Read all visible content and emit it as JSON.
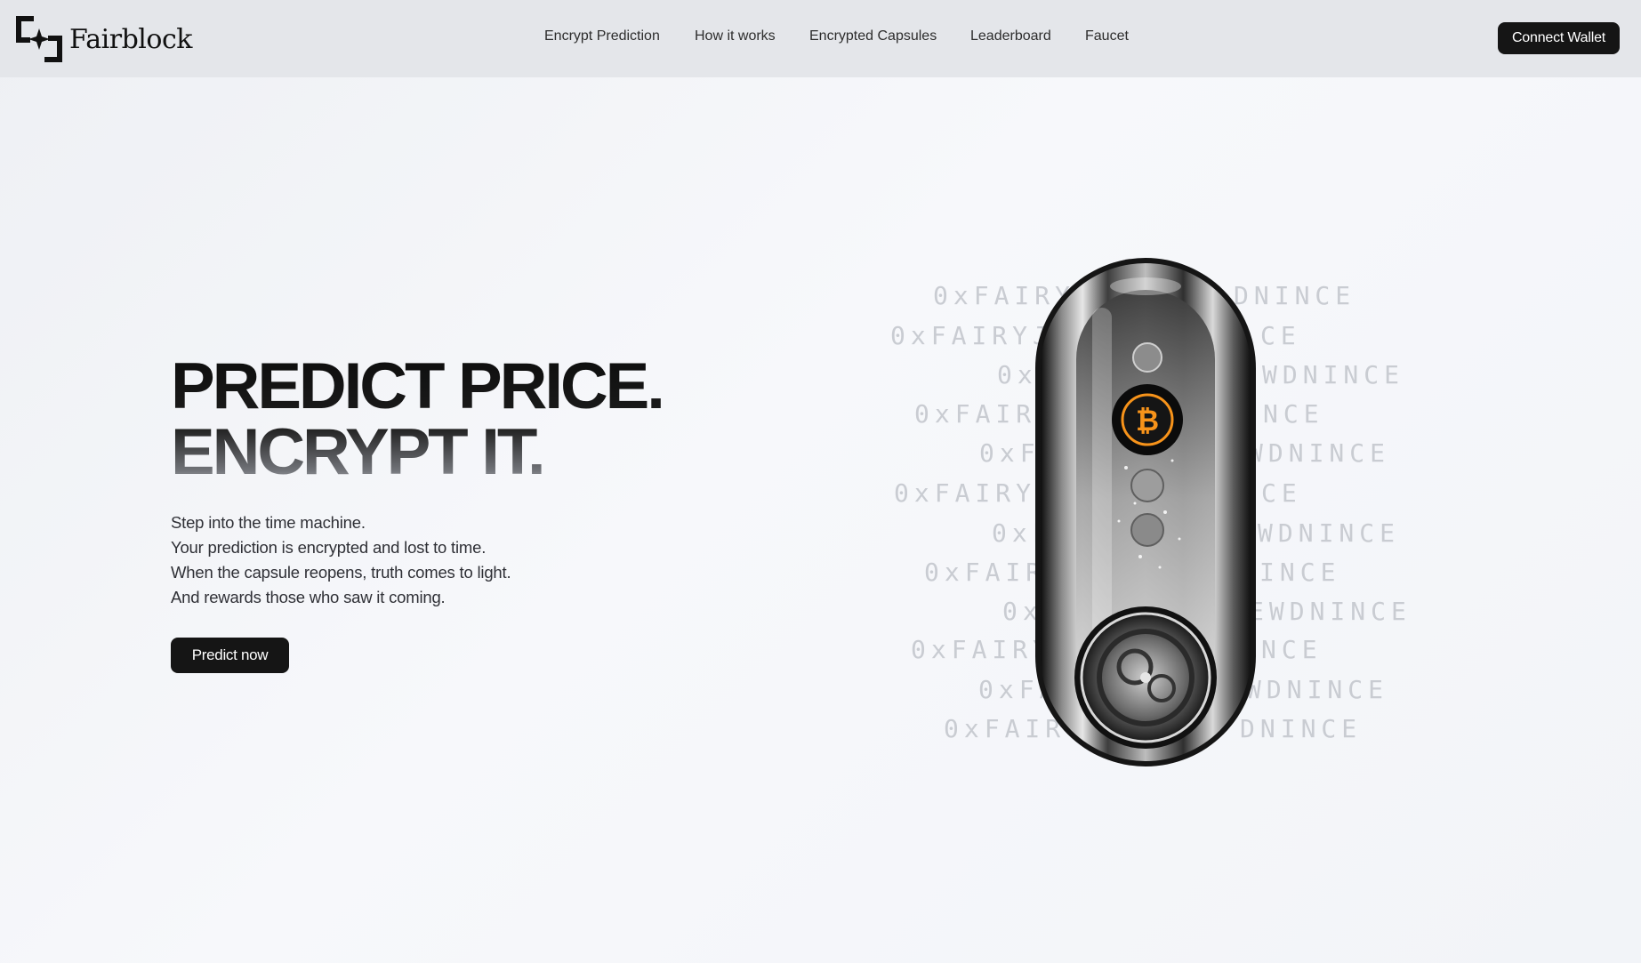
{
  "brand": {
    "name": "Fairblock"
  },
  "nav": {
    "items": [
      {
        "label": "Encrypt Prediction"
      },
      {
        "label": "How it works"
      },
      {
        "label": "Encrypted Capsules"
      },
      {
        "label": "Leaderboard"
      },
      {
        "label": "Faucet"
      }
    ],
    "connect_label": "Connect Wallet"
  },
  "hero": {
    "title_line1": "PREDICT PRICE.",
    "title_line2": "ENCRYPT IT.",
    "lines": [
      "Step into the time machine.",
      "Your prediction is encrypted and lost to time.",
      "When the capsule reopens, truth comes to light.",
      "And rewards those who saw it coming."
    ],
    "cta_label": "Predict now"
  },
  "capsule_art": {
    "left_codes": [
      "0xFAIRYJW",
      "0xFAIRYJW",
      "0xF",
      "0xFAIRYJ",
      "0xFA",
      "0xFAIRYJW",
      "0xF",
      "0xFAIRY",
      "0x",
      "0xFAIRYJ",
      "0xFA",
      "0xFAIRY"
    ],
    "right_codes": [
      "DNINCE",
      "CE",
      "WDNINCE",
      "NCE",
      "WDNINCE",
      "CE",
      "WDNINCE",
      "INCE",
      "EWDNINCE",
      "NCE",
      "WDNINCE",
      "DNINCE"
    ],
    "coin_symbol": "₿",
    "accent_color": "#f7931a"
  }
}
